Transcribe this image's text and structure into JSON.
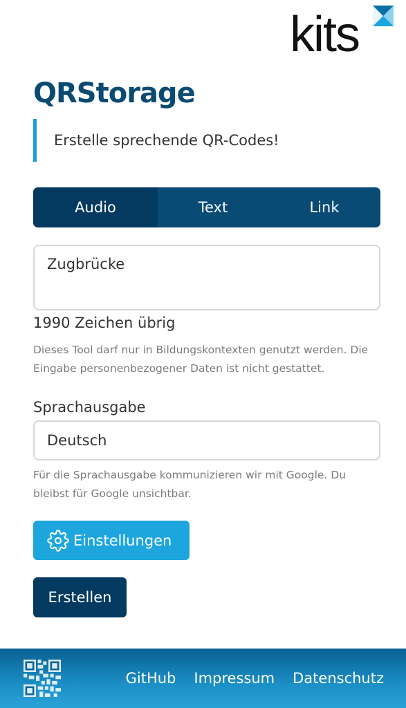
{
  "header": {
    "logo_text": "kits",
    "title": "QRStorage",
    "tagline": "Erstelle sprechende QR-Codes!"
  },
  "tabs": [
    {
      "label": "Audio",
      "active": true
    },
    {
      "label": "Text",
      "active": false
    },
    {
      "label": "Link",
      "active": false
    }
  ],
  "form": {
    "text_value": "Zugbrücke",
    "chars_remaining": "1990 Zeichen übrig",
    "privacy_hint": "Dieses Tool darf nur in Bildungskontexten genutzt werden. Die Eingabe personenbezogener Daten ist nicht gestattet.",
    "voice_label": "Sprachausgabe",
    "voice_selected": "Deutsch",
    "google_hint": "Für die Sprachausgabe kommunizieren wir mit Google. Du bleibst für Google unsichtbar.",
    "settings_label": "Einstellungen",
    "create_label": "Erstellen"
  },
  "footer": {
    "links": [
      "GitHub",
      "Impressum",
      "Datenschutz"
    ],
    "icon": "qr-code-icon"
  },
  "colors": {
    "brand_dark": "#053a60",
    "brand": "#0a4b76",
    "accent": "#1ca6dd",
    "title": "#0b4a72"
  }
}
